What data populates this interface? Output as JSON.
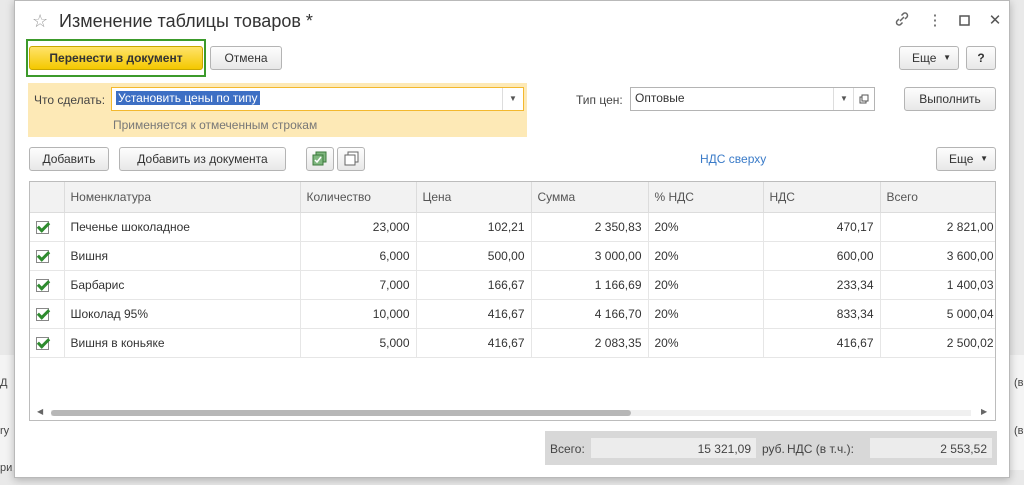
{
  "window": {
    "title": "Изменение таблицы товаров *"
  },
  "icons": [
    "star-icon",
    "link-icon",
    "more-vertical-icon",
    "maximize-icon",
    "close-icon",
    "dropdown-arrow-icon",
    "open-icon",
    "check-all-icon",
    "uncheck-all-icon",
    "checkbox-icon"
  ],
  "toolbar": {
    "transfer_label": "Перенести в документ",
    "cancel_label": "Отмена",
    "more_label": "Еще",
    "help_label": "?"
  },
  "action": {
    "label": "Что сделать:",
    "value": "Установить цены по типу",
    "hint": "Применяется к отмеченным строкам"
  },
  "price_type": {
    "label": "Тип цен:",
    "value": "Оптовые",
    "execute_label": "Выполнить"
  },
  "table_toolbar": {
    "add_label": "Добавить",
    "add_from_doc_label": "Добавить из документа",
    "vat_link": "НДС сверху",
    "more_label": "Еще"
  },
  "table": {
    "columns": [
      "Номенклатура",
      "Количество",
      "Цена",
      "Сумма",
      "% НДС",
      "НДС",
      "Всего"
    ],
    "rows": [
      {
        "checked": true,
        "name": "Печенье шоколадное",
        "qty": "23,000",
        "price": "102,21",
        "sum": "2 350,83",
        "vat_rate": "20%",
        "vat": "470,17",
        "total": "2 821,00"
      },
      {
        "checked": true,
        "name": "Вишня",
        "qty": "6,000",
        "price": "500,00",
        "sum": "3 000,00",
        "vat_rate": "20%",
        "vat": "600,00",
        "total": "3 600,00"
      },
      {
        "checked": true,
        "name": "Барбарис",
        "qty": "7,000",
        "price": "166,67",
        "sum": "1 166,69",
        "vat_rate": "20%",
        "vat": "233,34",
        "total": "1 400,03"
      },
      {
        "checked": true,
        "name": "Шоколад 95%",
        "qty": "10,000",
        "price": "416,67",
        "sum": "4 166,70",
        "vat_rate": "20%",
        "vat": "833,34",
        "total": "5 000,04"
      },
      {
        "checked": true,
        "name": "Вишня в коньяке",
        "qty": "5,000",
        "price": "416,67",
        "sum": "2 083,35",
        "vat_rate": "20%",
        "vat": "416,67",
        "total": "2 500,02"
      }
    ]
  },
  "totals": {
    "total_label": "Всего:",
    "total_value": "15 321,09",
    "currency": "руб.",
    "vat_label": "НДС (в т.ч.):",
    "vat_value": "2 553,52"
  }
}
